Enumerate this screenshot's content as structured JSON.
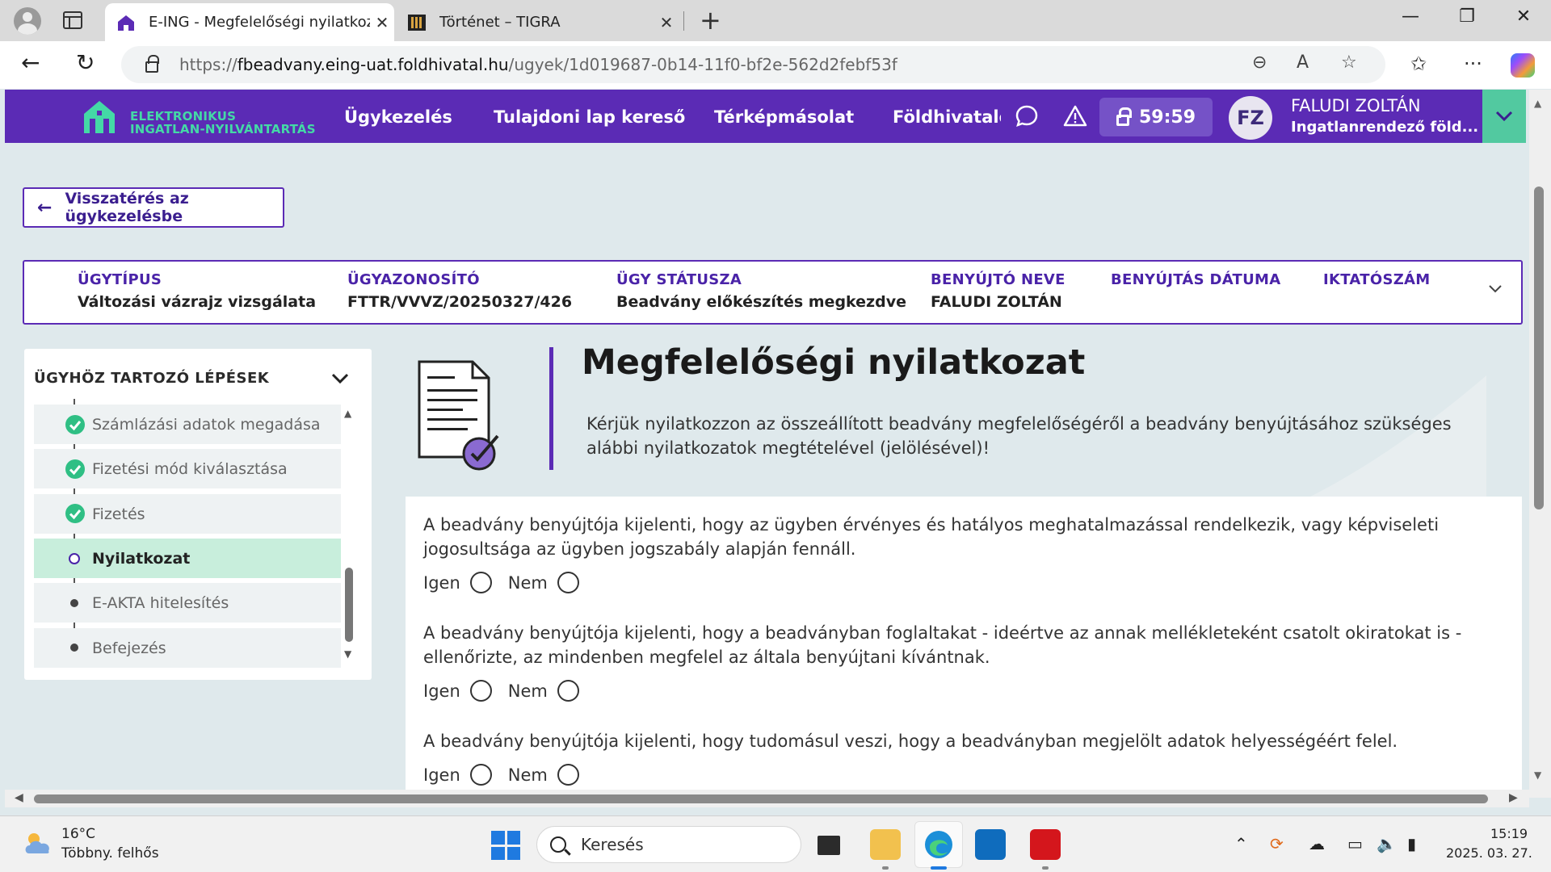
{
  "browser": {
    "tabs": [
      {
        "title": "E-ING - Megfelelőségi nyilatkozat",
        "active": true
      },
      {
        "title": "Történet – TIGRA",
        "active": false
      }
    ],
    "url_prefix": "https://",
    "url_domain": "fbeadvany.eing-uat.foldhivatal.hu",
    "url_path": "/ugyek/1d019687-0b14-11f0-bf2e-562d2febf53f"
  },
  "header": {
    "logo_line1": "ELEKTRONIKUS",
    "logo_line2": "INGATLAN-NYILVÁNTARTÁS",
    "nav": [
      "Ügykezelés",
      "Tulajdoni lap kereső",
      "Térképmásolat",
      "Földhivatalo"
    ],
    "timer": "59:59",
    "user_initials": "FZ",
    "user_name": "FALUDI ZOLTÁN",
    "user_role": "Ingatlanrendező föld..."
  },
  "back_button": "Visszatérés az ügykezelésbe",
  "case_info": [
    {
      "label": "ÜGYTÍPUS",
      "value": "Változási vázrajz vizsgálata"
    },
    {
      "label": "ÜGYAZONOSÍTÓ",
      "value": "FTTR/VVVZ/20250327/426"
    },
    {
      "label": "ÜGY STÁTUSZA",
      "value": "Beadvány előkészítés megkezdve"
    },
    {
      "label": "BENYÚJTÓ NEVE",
      "value": "FALUDI ZOLTÁN"
    },
    {
      "label": "BENYÚJTÁS DÁTUMA",
      "value": ""
    },
    {
      "label": "IKTATÓSZÁM",
      "value": ""
    }
  ],
  "steps": {
    "title": "ÜGYHÖZ TARTOZÓ LÉPÉSEK",
    "items": [
      {
        "label": "Számlázási adatok megadása",
        "state": "done"
      },
      {
        "label": "Fizetési mód kiválasztása",
        "state": "done"
      },
      {
        "label": "Fizetés",
        "state": "done"
      },
      {
        "label": "Nyilatkozat",
        "state": "current"
      },
      {
        "label": "E-AKTA hitelesítés",
        "state": "pending"
      },
      {
        "label": "Befejezés",
        "state": "pending"
      }
    ]
  },
  "main": {
    "title": "Megfelelőségi nyilatkozat",
    "description": "Kérjük nyilatkozzon az összeállított beadvány megfelelőségéről a beadvány benyújtásához szükséges alábbi nyilatkozatok megtételével (jelölésével)!",
    "yes_label": "Igen",
    "no_label": "Nem",
    "declarations": [
      "A beadvány benyújtója kijelenti, hogy az ügyben érvényes és hatályos meghatalmazással rendelkezik, vagy képviseleti jogosultsága az ügyben jogszabály alapján fennáll.",
      "A beadvány benyújtója kijelenti, hogy a beadványban foglaltakat - ideértve az annak mellékleteként csatolt okiratokat is - ellenőrizte, az mindenben megfelel az általa benyújtani kívántnak.",
      "A beadvány benyújtója kijelenti, hogy tudomásul veszi, hogy a beadványban megjelölt adatok helyességéért felel."
    ]
  },
  "taskbar": {
    "temperature": "16°C",
    "weather": "Többny. felhős",
    "search_placeholder": "Keresés",
    "time": "15:19",
    "date": "2025. 03. 27."
  },
  "colors": {
    "brand_purple": "#5b2bb5",
    "brand_green": "#44d9a6",
    "success": "#2fbf84"
  }
}
